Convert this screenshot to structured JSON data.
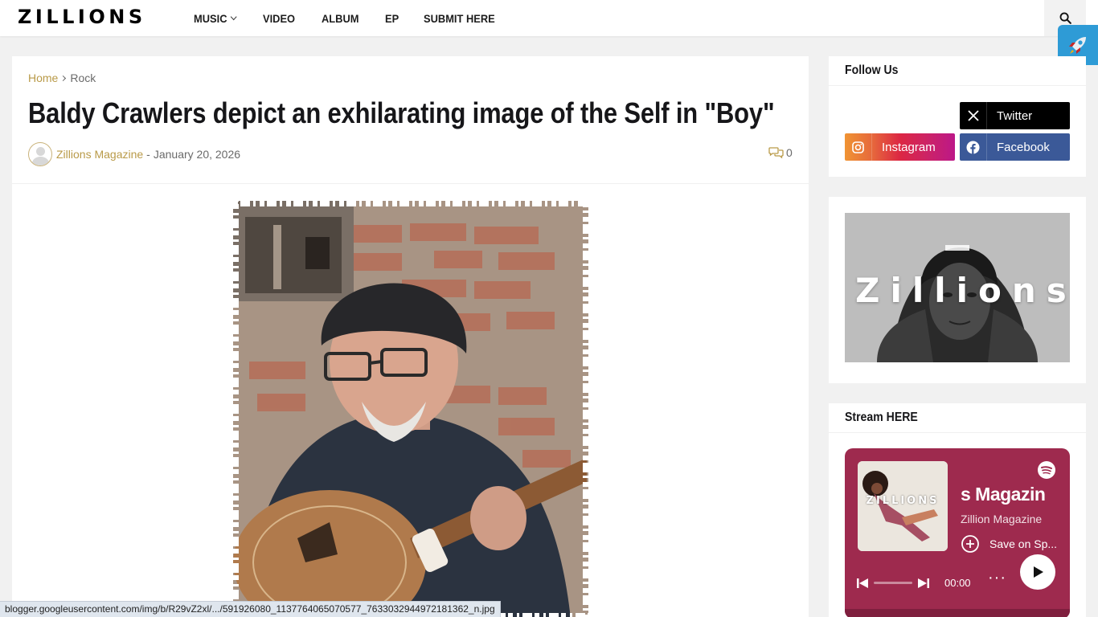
{
  "header": {
    "logo": "ZILLIONS",
    "nav": [
      {
        "label": "MUSIC",
        "has_dropdown": true
      },
      {
        "label": "VIDEO"
      },
      {
        "label": "ALBUM"
      },
      {
        "label": "EP"
      },
      {
        "label": "SUBMIT HERE"
      }
    ],
    "search_icon": "search-icon",
    "rocket_icon": "rocket-icon"
  },
  "post": {
    "breadcrumb": {
      "home": "Home",
      "category": "Rock"
    },
    "title": "Baldy Crawlers depict an exhilarating image of the Self in \"Boy\"",
    "author": "Zillions Magazine",
    "separator": "-",
    "date": "January 20, 2026",
    "comment_count": "0"
  },
  "status_url": "blogger.googleusercontent.com/img/b/R29vZ2xl/.../591926080_1137764065070577_7633032944972181362_n.jpg",
  "sidebar": {
    "follow": {
      "title": "Follow Us",
      "twitter": "Twitter",
      "instagram": "Instagram",
      "facebook": "Facebook"
    },
    "banner": {
      "text": "Zillions"
    },
    "stream": {
      "title": "Stream HERE",
      "cover_text": "ZILLIONS",
      "playlist_title": "s Magazin",
      "playlist_owner": "Zillion Magazine",
      "save_label": "Save on Sp...",
      "time": "00:00"
    }
  },
  "colors": {
    "accent": "#b99a48",
    "spotify_bg": "#9e2a4e",
    "rocket": "#2e9bd6"
  }
}
